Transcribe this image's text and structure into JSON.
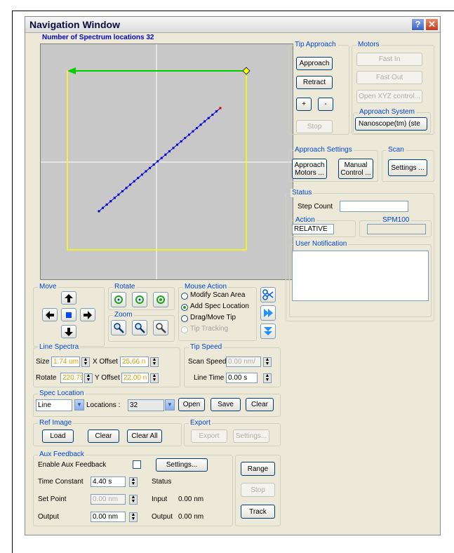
{
  "window": {
    "title": "Navigation Window",
    "help_glyph": "?",
    "close_glyph": "✕"
  },
  "scan_area": {
    "header": "Number of Spectrum locations 32",
    "spectrum_points": 32,
    "colors": {
      "background": "#c8c8c8",
      "scan_box": "#ffff00",
      "arrow": "#00cc00",
      "spec_line": "#0000dd",
      "end_marker": "#cc0000"
    }
  },
  "tip_approach": {
    "title": "Tip Approach",
    "approach": "Approach",
    "retract": "Retract",
    "plus": "+",
    "minus": "-",
    "stop": "Stop"
  },
  "motors": {
    "title": "Motors",
    "fast_in": "Fast In",
    "fast_out": "Fast Out",
    "open_xyz": "Open XYZ control..."
  },
  "approach_system": {
    "title": "Approach System",
    "value": "Nanoscope(tm) (ste"
  },
  "approach_settings": {
    "title": "Approach Settings",
    "approach_motors": "Approach Motors ...",
    "manual_control": "Manual Control ..."
  },
  "scan": {
    "title": "Scan",
    "settings": "Settings ..."
  },
  "status": {
    "title": "Status",
    "step_count_label": "Step Count",
    "step_count_value": "",
    "action_title": "Action",
    "action_value": "RELATIVE",
    "spm100_title": "SPM100",
    "spm100_value": "",
    "user_notification_title": "User Notification",
    "user_notification_text": ""
  },
  "move": {
    "title": "Move"
  },
  "rotate": {
    "title": "Rotate"
  },
  "zoom": {
    "title": "Zoom"
  },
  "mouse_action": {
    "title": "Mouse Action",
    "options": [
      "Modify Scan Area",
      "Add Spec Location",
      "Drag/Move Tip",
      "Tip Tracking"
    ],
    "selected": "Add Spec Location"
  },
  "line_spectra": {
    "title": "Line Spectra",
    "size_label": "Size",
    "size_value": "1.74 um",
    "x_offset_label": "X Offset",
    "x_offset_value": "25.66 n",
    "rotate_label": "Rotate",
    "rotate_value": "220.79",
    "y_offset_label": "Y Offset",
    "y_offset_value": "22.00 n"
  },
  "tip_speed": {
    "title": "Tip Speed",
    "scan_speed_label": "Scan Speed",
    "scan_speed_value": "0.00 nm/",
    "line_time_label": "Line Time",
    "line_time_value": "0.00 s"
  },
  "spec_location": {
    "title": "Spec Location",
    "type_value": "Line",
    "locations_label": "Locations :",
    "locations_value": "32",
    "open": "Open",
    "save": "Save",
    "clear": "Clear"
  },
  "ref_image": {
    "title": "Ref Image",
    "load": "Load",
    "clear": "Clear",
    "clear_all": "Clear All"
  },
  "export": {
    "title": "Export",
    "export": "Export",
    "settings": "Settings..."
  },
  "aux_feedback": {
    "title": "Aux Feedback",
    "enable_label": "Enable Aux Feedback",
    "settings": "Settings...",
    "time_constant_label": "Time Constant",
    "time_constant_value": "4.40 s",
    "status_label": "Status",
    "set_point_label": "Set Point",
    "set_point_value": "0.00 nm",
    "input_label": "Input",
    "input_value": "0.00 nm",
    "output_label": "Output",
    "output_value": "0.00 nm",
    "output2_label": "Output",
    "output2_value": "0.00 nm"
  },
  "side_buttons": {
    "range": "Range",
    "stop": "Stop",
    "track": "Track"
  }
}
